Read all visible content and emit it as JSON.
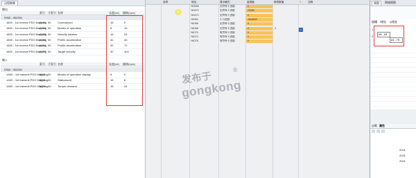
{
  "left": {
    "tab_label": "过程映像",
    "output_label": "输出",
    "input_label": "输入",
    "pdo_label": "PDO",
    "columns": {
      "name": "名称",
      "index": "索引",
      "subindex": "子索引",
      "objname": "名称",
      "bitlen": "长度(bit)",
      "byteoffset": "偏移(byte)"
    },
    "out_group": "0368 - IS620N",
    "in_group": "0368 - IS620N",
    "out_rows": [
      {
        "pdo": "1600 - 1st receive PDO Mapping",
        "idx": "6040",
        "sub": "00",
        "name": "Controlword",
        "len": "16",
        "off": "0"
      },
      {
        "pdo": "1600 - 1st receive PDO Mapping",
        "idx": "6060",
        "sub": "00",
        "name": "Modes of operation",
        "len": "8",
        "off": "16"
      },
      {
        "pdo": "1600 - 1st receive PDO Mapping",
        "idx": "606D",
        "sub": "00",
        "name": "Velocity window",
        "len": "16",
        "off": "24"
      },
      {
        "pdo": "1600 - 1st receive PDO Mapping",
        "idx": "6083",
        "sub": "00",
        "name": "Profile acceleration",
        "len": "32",
        "off": "40"
      },
      {
        "pdo": "1600 - 1st receive PDO Mapping",
        "idx": "6084",
        "sub": "00",
        "name": "Profile deceleration",
        "len": "32",
        "off": "72"
      },
      {
        "pdo": "1600 - 1st receive PDO Mapping",
        "idx": "60FF",
        "sub": "00",
        "name": "Target velocity",
        "len": "32",
        "off": "104"
      }
    ],
    "in_rows": [
      {
        "pdo": "1A00 - 1st transmit PDO Mapping",
        "idx": "6061",
        "sub": "00",
        "name": "Modes of operation display",
        "len": "8",
        "off": "0"
      },
      {
        "pdo": "1A00 - 1st transmit PDO Mapping",
        "idx": "6041",
        "sub": "00",
        "name": "Statusword",
        "len": "16",
        "off": "8"
      },
      {
        "pdo": "1A00 - 1st transmit PDO Mapping",
        "idx": "6074",
        "sub": "00",
        "name": "Torque demand",
        "len": "16",
        "off": "24"
      }
    ]
  },
  "mid": {
    "columns": {
      "name": "名称",
      "addr": "地址",
      "fmt": "显示格式",
      "monitor": "监视值",
      "modify": "修改数值",
      "comment": "注释"
    },
    "rows": [
      {
        "addr": "%IW68",
        "fmt": "无符号十进制",
        "mon": "0"
      },
      {
        "addr": "%IW70",
        "fmt": "无符号十进制",
        "mon": "29480"
      },
      {
        "addr": "%IW72",
        "fmt": "无符号十进制",
        "mon": "0"
      },
      {
        "addr": "%ID64",
        "fmt": "十六进制",
        "mon": "16#8800"
      },
      {
        "addr": "%ID68",
        "fmt": "无符号十进制",
        "mon": "0"
      },
      {
        "addr": "%ID68",
        "fmt": "无符号十进制",
        "mon": "0",
        "mod": "3"
      },
      {
        "addr": "%ID70",
        "fmt": "有符号十进制",
        "mon": "0"
      },
      {
        "addr": "%ID74",
        "fmt": "有符号十进制",
        "mon": "0"
      },
      {
        "addr": "%ID78",
        "fmt": "有符号十进制",
        "mon": "0"
      }
    ]
  },
  "right": {
    "tabs": [
      "视图",
      "网络视图"
    ],
    "cols": {
      "a": "插槽",
      "b": "I地址",
      "c": "Q地址"
    },
    "rows": [
      {
        "slot": "1",
        "i": "",
        "q": ""
      },
      {
        "slot": "2",
        "i": "68...83",
        "q": ""
      },
      {
        "slot": "",
        "i": "",
        "q": "64...79"
      }
    ],
    "bottom_tabs": [
      "诊断",
      "属性"
    ],
    "bottom_rows": [
      "2021",
      "2021",
      "2021"
    ]
  },
  "watermark": {
    "line1": "发布于",
    "line2": "gongkong",
    "mark": "®"
  }
}
